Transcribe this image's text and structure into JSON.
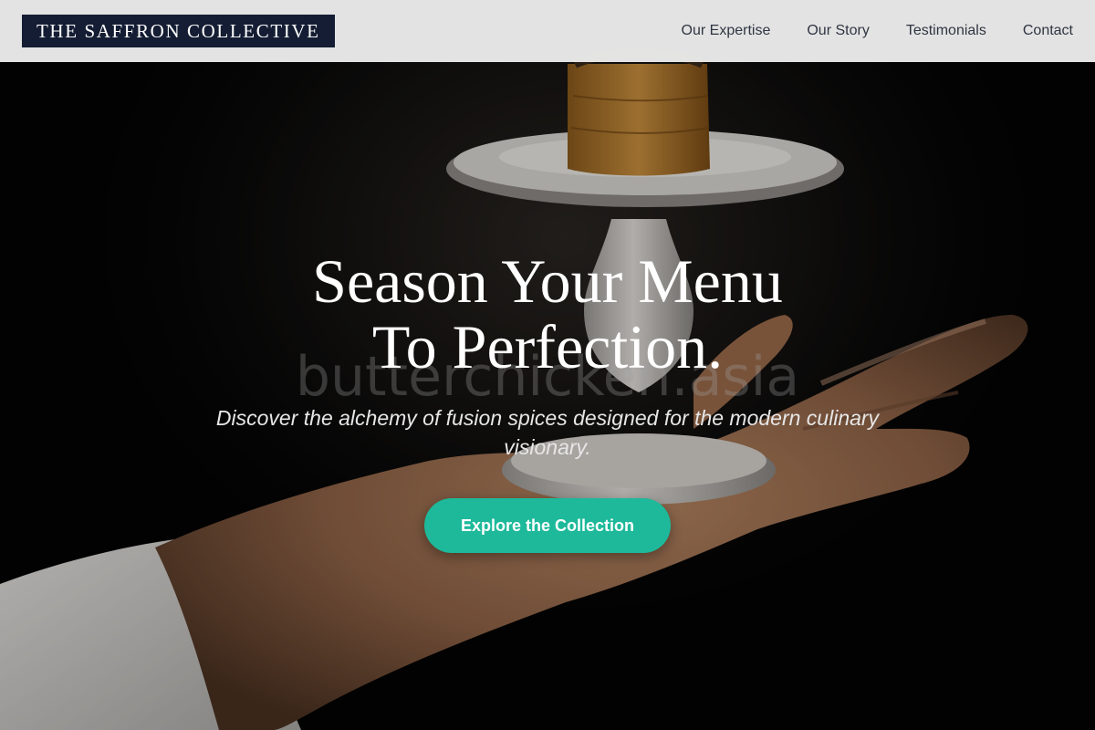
{
  "header": {
    "logo_text": "THE SAFFRON COLLECTIVE",
    "nav": [
      {
        "label": "Our Expertise"
      },
      {
        "label": "Our Story"
      },
      {
        "label": "Testimonials"
      },
      {
        "label": "Contact"
      }
    ]
  },
  "hero": {
    "watermark": "butterchicken.asia",
    "headline_line1": "Season Your Menu",
    "headline_line2": "To Perfection.",
    "subtitle": "Discover the alchemy of fusion spices designed for the modern culinary visionary.",
    "cta_label": "Explore the Collection",
    "background_image": "chef-hand-holding-dessert-pedestal-photo"
  },
  "colors": {
    "header_background": "#ececec",
    "logo_background": "#141d33",
    "nav_text": "#2f3542",
    "cta_background": "#1db99a",
    "headline_text": "#ffffff"
  }
}
